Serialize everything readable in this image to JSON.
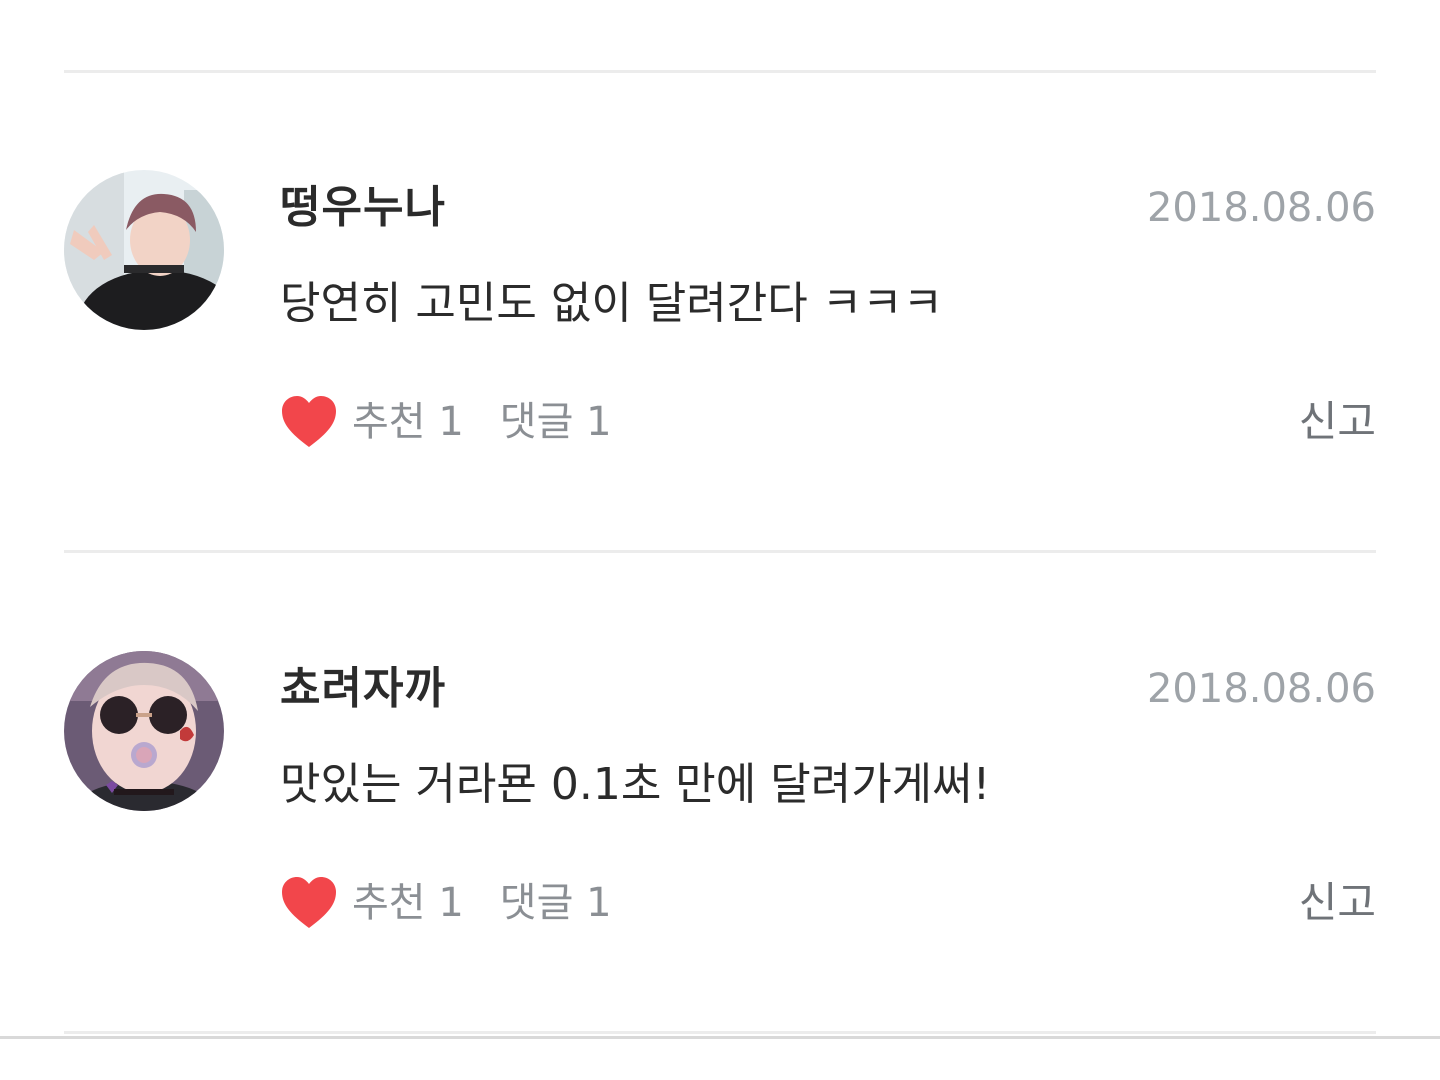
{
  "comments": [
    {
      "author": "떵우누나",
      "date": "2018.08.06",
      "text": "당연히 고민도 없이 달려간다 ㅋㅋㅋ",
      "like_label": "추천",
      "like_count": "1",
      "reply_label": "댓글",
      "reply_count": "1",
      "report_label": "신고"
    },
    {
      "author": "쵸려자까",
      "date": "2018.08.06",
      "text": "맛있는 거라묜 0.1초 만에 달려가게써!",
      "like_label": "추천",
      "like_count": "1",
      "reply_label": "댓글",
      "reply_count": "1",
      "report_label": "신고"
    }
  ],
  "icons": {
    "heart": "heart-icon",
    "avatar": "user-avatar-photo"
  },
  "colors": {
    "heart": "#f2464b",
    "date": "#9ea3a8",
    "divider": "#ececec",
    "text": "#2b2b2b",
    "action": "#8b8f94"
  }
}
